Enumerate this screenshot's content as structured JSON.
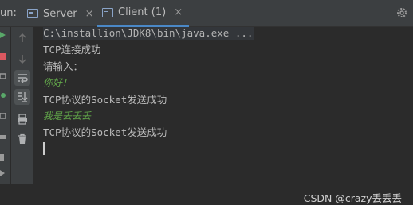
{
  "run_label": "un:",
  "tabs": [
    {
      "label": "Server",
      "icon": "console-tab-icon"
    },
    {
      "label": "Client (1)",
      "icon": "console-tab-icon",
      "active": true
    }
  ],
  "console": {
    "lines": [
      {
        "text": "C:\\installion\\JDK8\\bin\\java.exe ...",
        "kind": "cmd"
      },
      {
        "text": "TCP连接成功",
        "kind": "out"
      },
      {
        "text": "请输入：",
        "kind": "out"
      },
      {
        "text": "你好！",
        "kind": "input"
      },
      {
        "text": "TCP协议的Socket发送成功",
        "kind": "out"
      },
      {
        "text": "我是丢丢丢",
        "kind": "input"
      },
      {
        "text": "TCP协议的Socket发送成功",
        "kind": "out"
      }
    ]
  },
  "watermark": "CSDN @crazy丢丢丢",
  "colors": {
    "background": "#2b2b2b",
    "toolbar": "#3c3f41",
    "accent": "#4a88c7",
    "user_input": "#62a74a",
    "text": "#bbbbbb"
  }
}
